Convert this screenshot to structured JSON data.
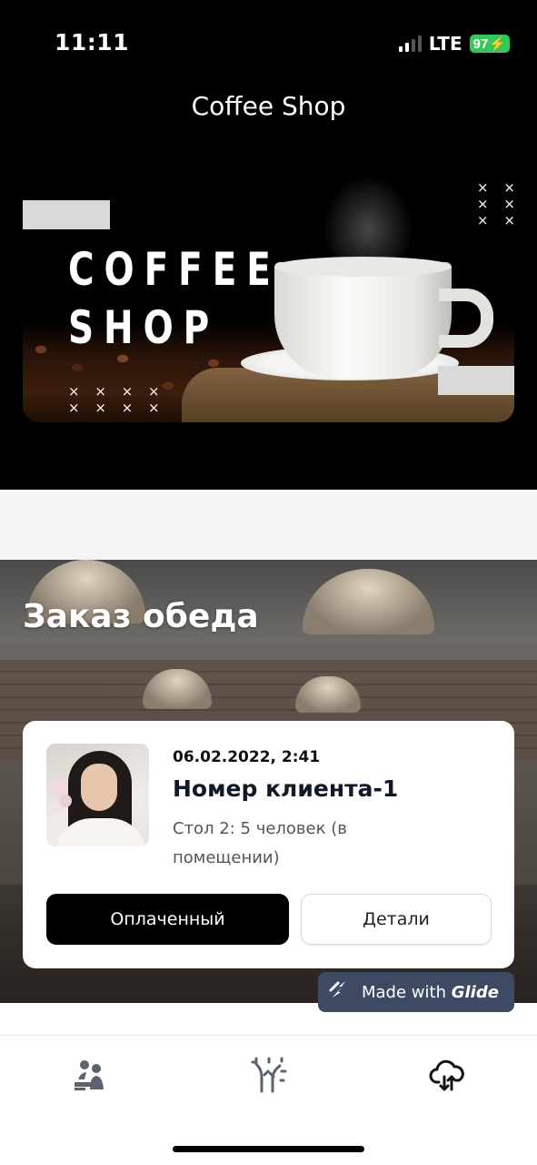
{
  "status_bar": {
    "time": "11:11",
    "network": "LTE",
    "battery": "97"
  },
  "header": {
    "title": "Coffee Shop"
  },
  "banner": {
    "line1": "COFFEE",
    "line2": "SHOP",
    "x_pattern_top": "× ×\n× ×\n× ×",
    "x_pattern_bottom": "× × × ×\n× × × ×"
  },
  "section": {
    "title": "Заказ обеда"
  },
  "order": {
    "date": "06.02.2022, 2:41",
    "client": "Номер клиента-1",
    "table": "Стол 2: 5 человек (в помещении)",
    "paid_label": "Оплаченный",
    "details_label": "Детали"
  },
  "badge": {
    "made_with": "Made with",
    "brand": "Glide"
  },
  "tabs": [
    {
      "icon": "people-desk-icon"
    },
    {
      "icon": "tree-sun-icon"
    },
    {
      "icon": "cloud-sync-icon"
    }
  ],
  "colors": {
    "accent": "#000000",
    "battery": "#34c759",
    "badge": "#3e4a63"
  }
}
